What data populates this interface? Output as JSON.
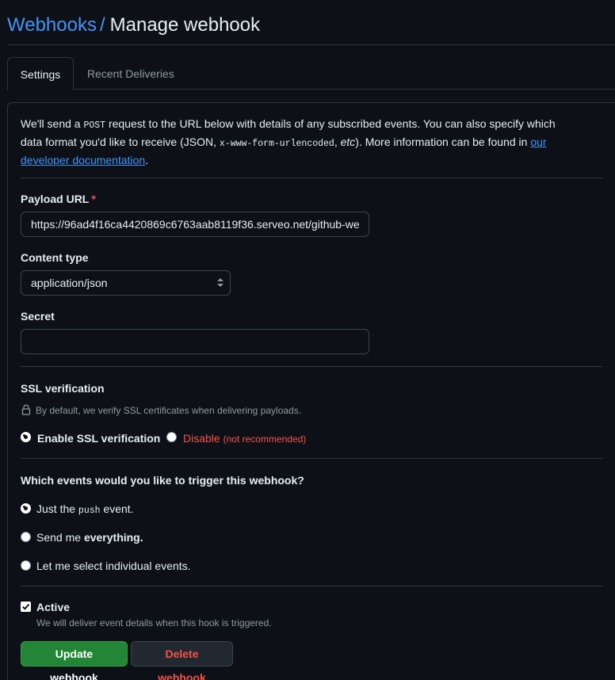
{
  "header": {
    "crumb": "Webhooks",
    "separator": "/",
    "title": "Manage webhook"
  },
  "tabs": [
    {
      "label": "Settings"
    },
    {
      "label": "Recent Deliveries"
    }
  ],
  "intro": {
    "part1": "We'll send a ",
    "code1": "POST",
    "part2": " request to the URL below with details of any subscribed events. You can also specify which data format you'd like to receive (JSON, ",
    "code2": "x-www-form-urlencoded",
    "part3": ", ",
    "etc": "etc",
    "part4": "). More information can be found in ",
    "link": "our developer documentation",
    "part5": "."
  },
  "payload_url": {
    "label": "Payload URL",
    "required_mark": "*",
    "value": "https://96ad4f16ca4420869c6763aab8119f36.serveo.net/github-we"
  },
  "content_type": {
    "label": "Content type",
    "value": "application/json"
  },
  "secret": {
    "label": "Secret",
    "value": ""
  },
  "ssl": {
    "label": "SSL verification",
    "note": "By default, we verify SSL certificates when delivering payloads.",
    "enable_label": "Enable SSL verification",
    "disable_label": "Disable",
    "disable_note": "(not recommended)"
  },
  "events": {
    "label": "Which events would you like to trigger this webhook?",
    "just_push_pre": "Just the ",
    "just_push_code": "push",
    "just_push_post": " event.",
    "everything_pre": "Send me ",
    "everything_bold": "everything.",
    "individual": "Let me select individual events."
  },
  "active": {
    "label": "Active",
    "note": "We will deliver event details when this hook is triggered."
  },
  "buttons": {
    "update": "Update webhook",
    "delete": "Delete webhook"
  },
  "colors": {
    "link": "#4493f8",
    "danger": "#f85149",
    "primary_button": "#238636",
    "background": "#0d1117",
    "border": "#30363d"
  }
}
